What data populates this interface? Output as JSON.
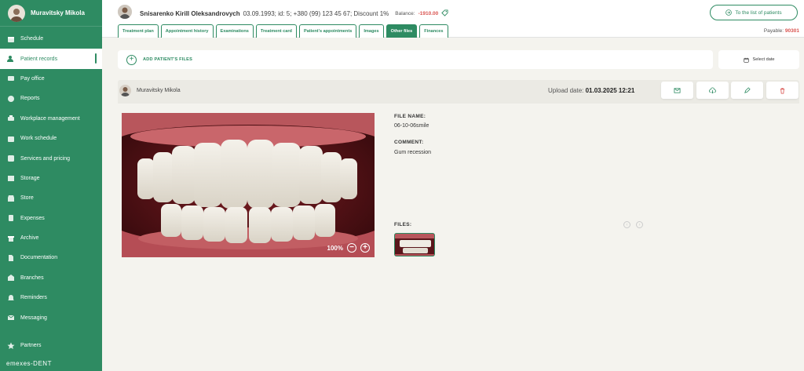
{
  "sidebar": {
    "user_name": "Muravitsky Mikola",
    "items": [
      {
        "label": "Schedule",
        "icon": "calendar-icon"
      },
      {
        "label": "Patient records",
        "icon": "patient-icon"
      },
      {
        "label": "Pay office",
        "icon": "wallet-icon"
      },
      {
        "label": "Reports",
        "icon": "reports-icon"
      },
      {
        "label": "Workplace management",
        "icon": "workplace-icon"
      },
      {
        "label": "Work schedule",
        "icon": "work-schedule-icon"
      },
      {
        "label": "Services and pricing",
        "icon": "services-icon"
      },
      {
        "label": "Storage",
        "icon": "storage-icon"
      },
      {
        "label": "Store",
        "icon": "store-icon"
      },
      {
        "label": "Expenses",
        "icon": "expenses-icon"
      },
      {
        "label": "Archive",
        "icon": "archive-icon"
      },
      {
        "label": "Documentation",
        "icon": "documentation-icon"
      },
      {
        "label": "Branches",
        "icon": "branches-icon"
      },
      {
        "label": "Reminders",
        "icon": "bell-icon"
      },
      {
        "label": "Messaging",
        "icon": "mail-icon"
      }
    ],
    "active_index": 1,
    "partners_label": "Partners",
    "logo_text": "emexes-DENT"
  },
  "header": {
    "patient_name": "Snisarenko Kirill Oleksandrovych",
    "patient_details": "03.09.1993; id: 5; +380 (99) 123 45 67; Discount 1%",
    "balance_label": "Balance:",
    "balance_value": "-1910.00",
    "to_list_label": "To the list of patients",
    "payable_label": "Payable:",
    "payable_value": "90301",
    "tabs": [
      {
        "label": "Treatment plan"
      },
      {
        "label": "Appointment history"
      },
      {
        "label": "Examinations"
      },
      {
        "label": "Treatment card"
      },
      {
        "label": "Patient's appointments"
      },
      {
        "label": "Images"
      },
      {
        "label": "Other files"
      },
      {
        "label": "Finances"
      }
    ],
    "active_tab": 6
  },
  "toolbar": {
    "add_files_label": "ADD PATIENT'S FILES",
    "select_date_label": "Select date"
  },
  "record": {
    "author": "Muravitsky Mikola",
    "upload_date_label": "Upload date:",
    "upload_date_value": "01.03.2025 12:21",
    "zoom_level": "100%",
    "file_name_label": "FILE NAME:",
    "file_name_value": "06-10-06smile",
    "comment_label": "COMMENT:",
    "comment_value": "Gum recession",
    "files_label": "FILES:"
  },
  "colors": {
    "brand": "#2e8b62",
    "negative": "#d9534f",
    "background": "#f4f3ee"
  }
}
